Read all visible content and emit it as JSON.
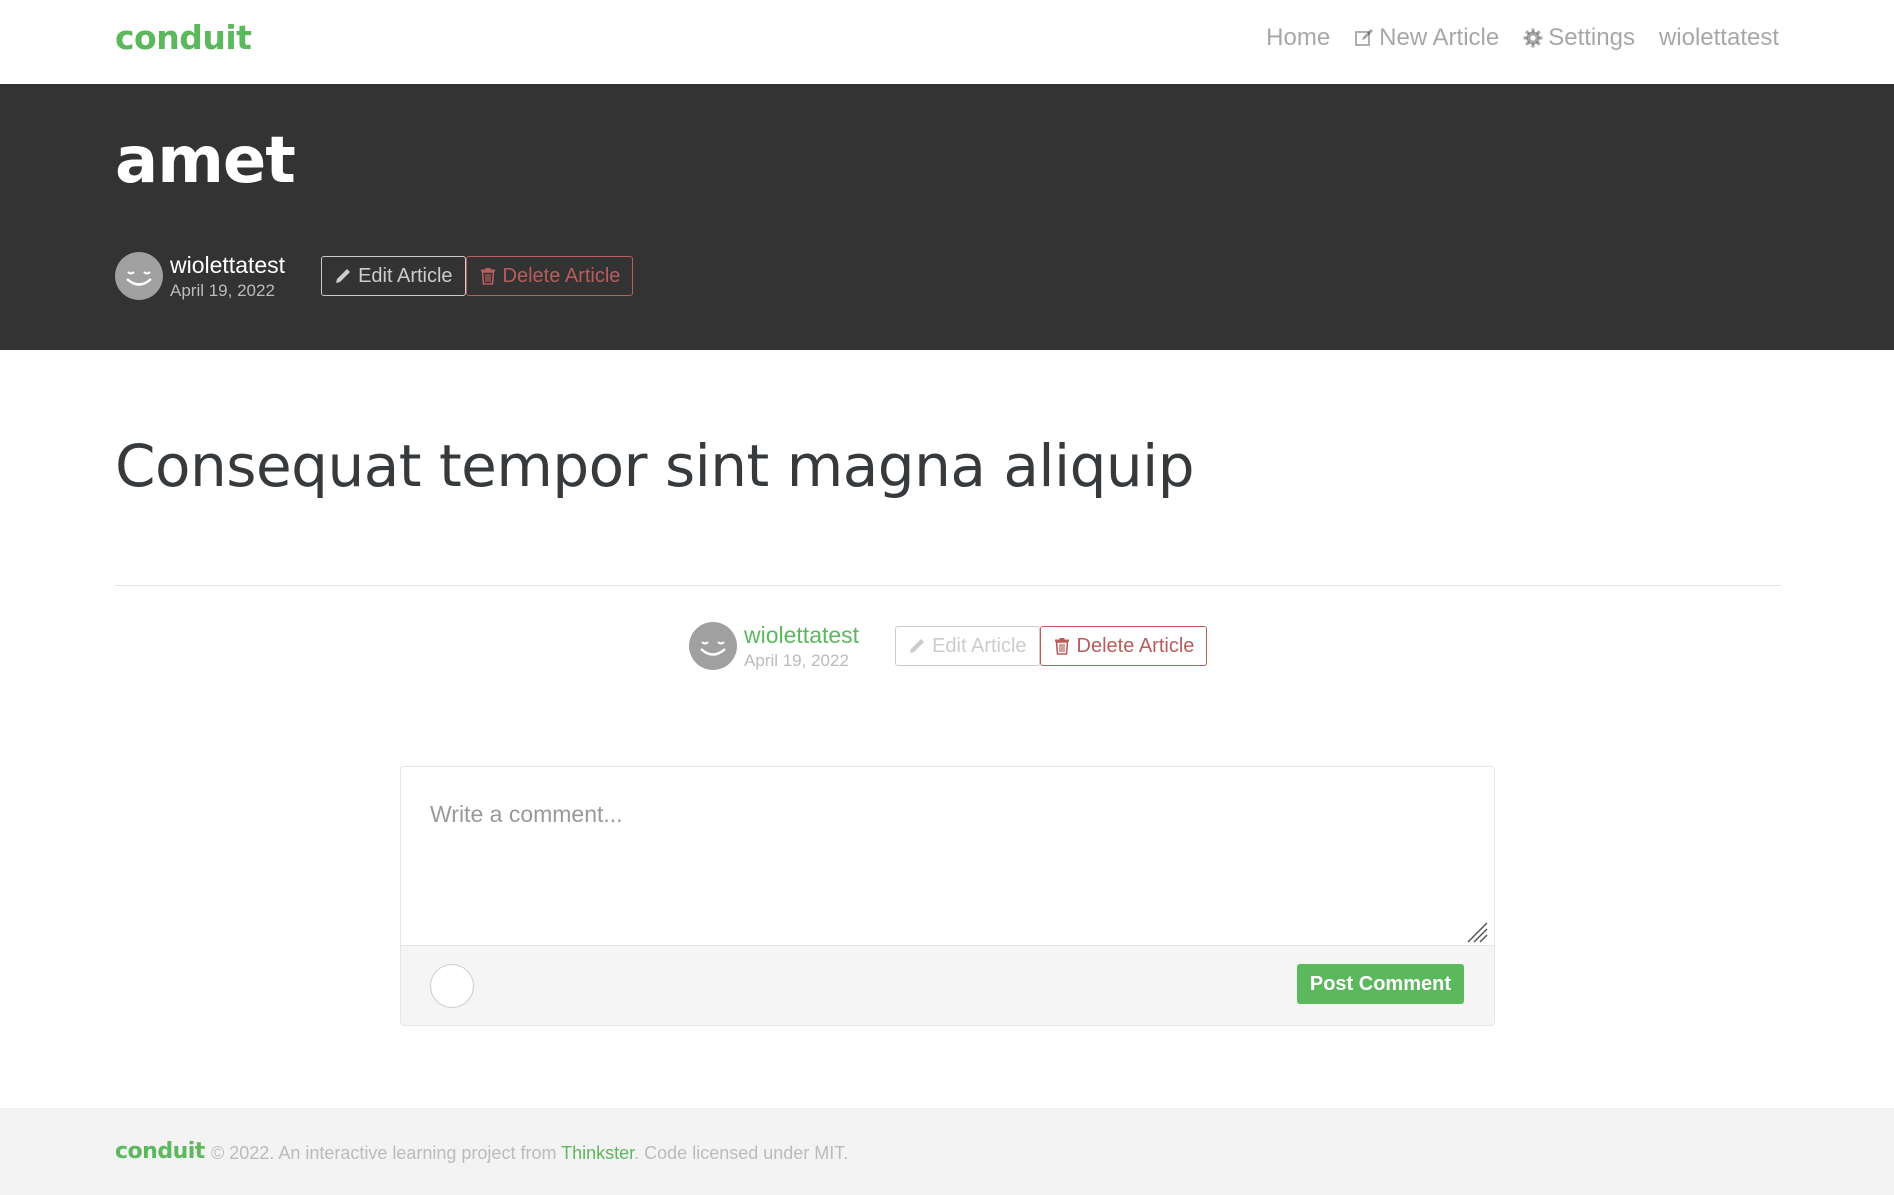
{
  "navbar": {
    "brand": "conduit",
    "links": {
      "home": "Home",
      "new_article": "New Article",
      "settings": "Settings",
      "profile": "wiolettatest"
    }
  },
  "banner": {
    "title": "amet",
    "author": "wiolettatest",
    "date": "April 19, 2022",
    "edit_label": "Edit Article",
    "delete_label": "Delete Article"
  },
  "article": {
    "body": "Consequat tempor sint magna aliquip"
  },
  "article_meta": {
    "author": "wiolettatest",
    "date": "April 19, 2022",
    "edit_label": "Edit Article",
    "delete_label": "Delete Article"
  },
  "comment_form": {
    "placeholder": "Write a comment...",
    "value": "",
    "submit_label": "Post Comment"
  },
  "footer": {
    "logo": "conduit",
    "text_before": "© 2022. An interactive learning project from ",
    "link": "Thinkster",
    "text_after": ". Code licensed under MIT."
  },
  "colors": {
    "brand": "#5cb85c",
    "banner_bg": "#333333",
    "danger": "#b85c5c",
    "muted": "#bbbbbb"
  },
  "icons": {
    "new_article": "edit-square-icon",
    "settings": "gear-icon",
    "edit": "pencil-icon",
    "delete": "trash-icon",
    "avatar": "smiley-avatar"
  }
}
